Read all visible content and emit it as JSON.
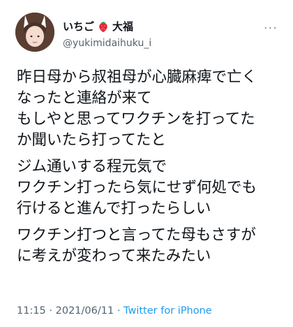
{
  "user": {
    "name_part1": "いちご",
    "name_part2": "大福",
    "handle": "@yukimidaihuku_i",
    "emoji_icon": "strawberry-icon"
  },
  "more_label": "···",
  "tweet": {
    "paragraphs": [
      [
        "昨日母から叔祖母が心臓麻痺で亡く",
        "なったと連絡が来て",
        "もしやと思ってワクチンを打ってた",
        "か聞いたら打ってたと"
      ],
      [
        "ジム通いする程元気で",
        "ワクチン打ったら気にせず何処でも",
        "行けると進んで打ったらしい"
      ],
      [
        "ワクチン打つと言ってた母もさすが",
        "に考えが変わって来たみたい"
      ]
    ]
  },
  "meta": {
    "time": "11:15",
    "date": "2021/06/11",
    "separator": "·",
    "source": "Twitter for iPhone"
  }
}
